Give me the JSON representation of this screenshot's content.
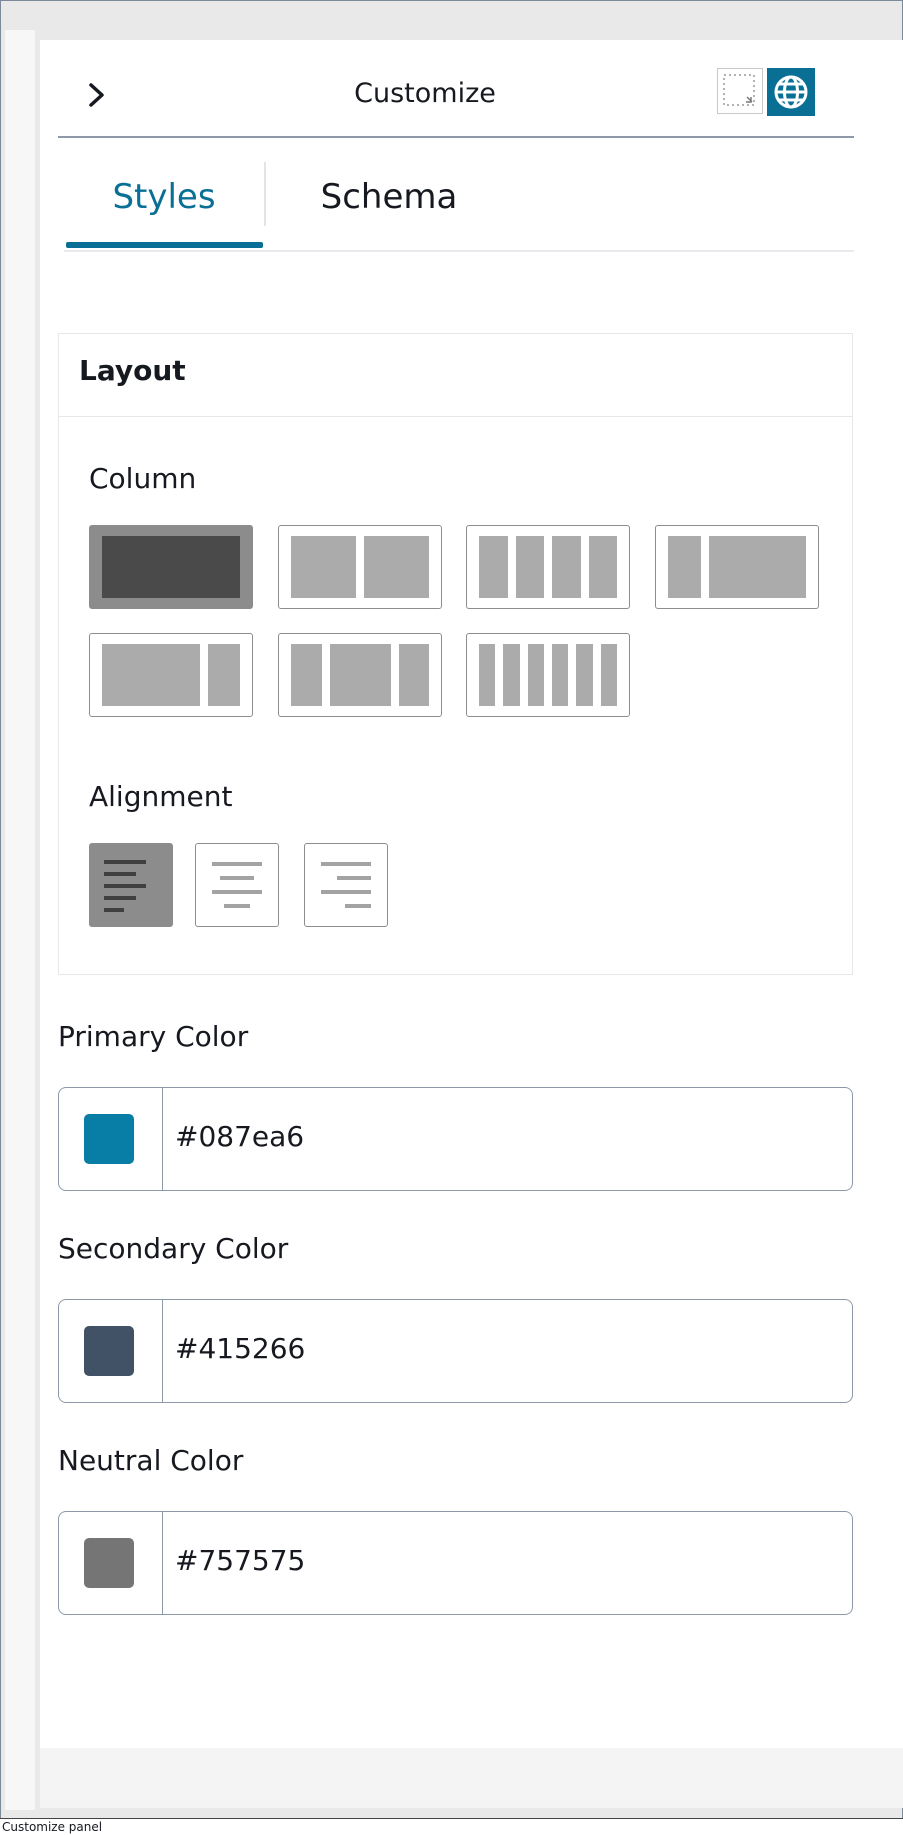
{
  "panel": {
    "title": "Customize",
    "caption": "Customize panel"
  },
  "icons": {
    "collapse": "chevron-right-icon",
    "frame": "dotted-frame-icon",
    "globe": "globe-icon"
  },
  "tabs": [
    {
      "label": "Styles",
      "active": true
    },
    {
      "label": "Schema",
      "active": false
    }
  ],
  "layout": {
    "title": "Layout",
    "column_label": "Column",
    "alignment_label": "Alignment",
    "column_options": [
      "single",
      "two-equal",
      "four-equal",
      "narrow-wide",
      "wide-narrow",
      "narrow-wide-narrow",
      "six-equal"
    ],
    "column_selected": "single",
    "alignment_options": [
      "left",
      "center",
      "right"
    ],
    "alignment_selected": "left"
  },
  "colors": {
    "primary": {
      "label": "Primary Color",
      "value": "#087ea6"
    },
    "secondary": {
      "label": "Secondary Color",
      "value": "#415266"
    },
    "neutral": {
      "label": "Neutral Color",
      "value": "#757575"
    }
  },
  "theme": {
    "accent": "#0a6f94",
    "selected_fill": "#8c8c8c"
  }
}
